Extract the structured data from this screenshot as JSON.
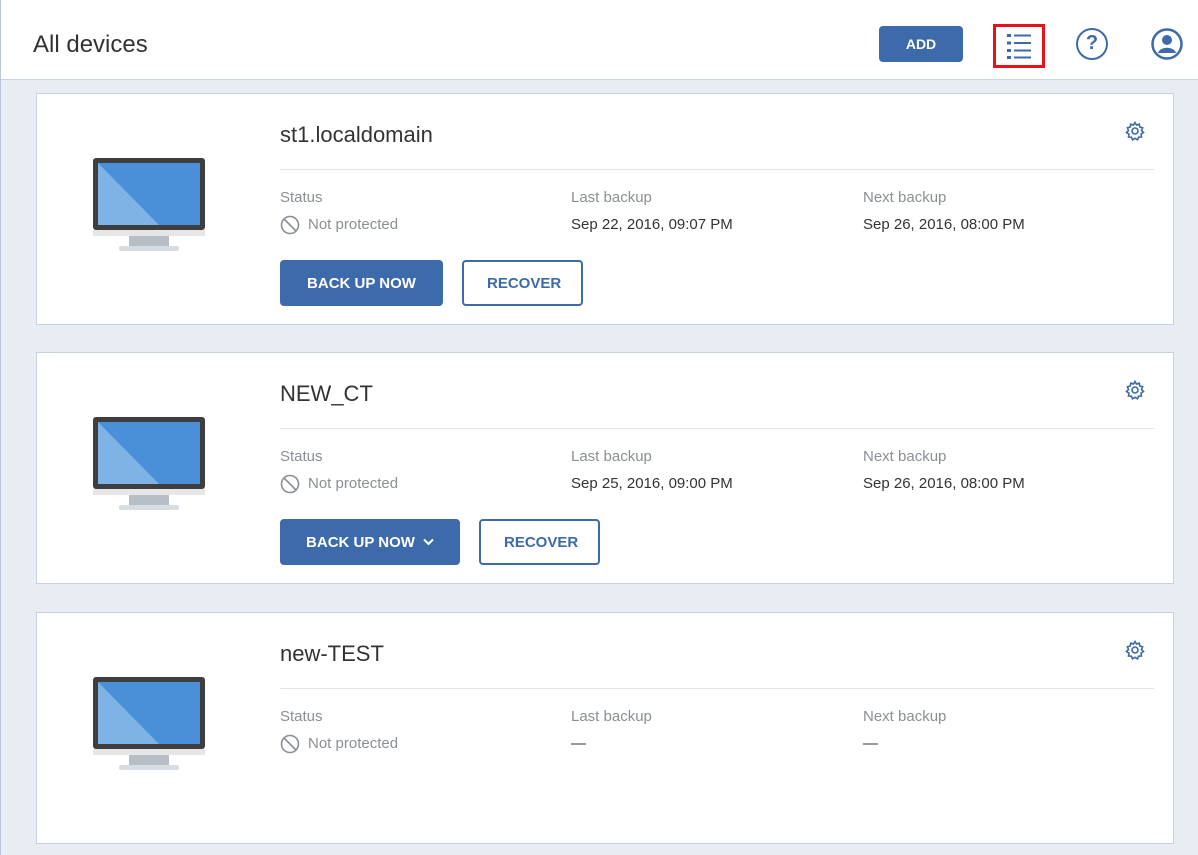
{
  "header": {
    "title": "All devices",
    "add_label": "ADD",
    "help_label": "?",
    "icons": [
      "list-view-icon",
      "help-icon",
      "account-icon"
    ]
  },
  "labels": {
    "status": "Status",
    "last_backup": "Last backup",
    "next_backup": "Next backup",
    "back_up_now": "BACK UP NOW",
    "recover": "RECOVER"
  },
  "devices": [
    {
      "name": "st1.localdomain",
      "status": "Not protected",
      "last_backup": "Sep 22, 2016, 09:07 PM",
      "next_backup": "Sep 26, 2016, 08:00 PM"
    },
    {
      "name": "NEW_CT",
      "status": "Not protected",
      "last_backup": "Sep 25, 2016, 09:00 PM",
      "next_backup": "Sep 26, 2016, 08:00 PM"
    },
    {
      "name": "new-TEST",
      "status": "Not protected",
      "last_backup": "—",
      "next_backup": "—"
    }
  ],
  "colors": {
    "accent": "#3d6aaa",
    "highlight_border": "#e8111a",
    "background": "#e8edf4",
    "muted_text": "#8a8f95"
  }
}
